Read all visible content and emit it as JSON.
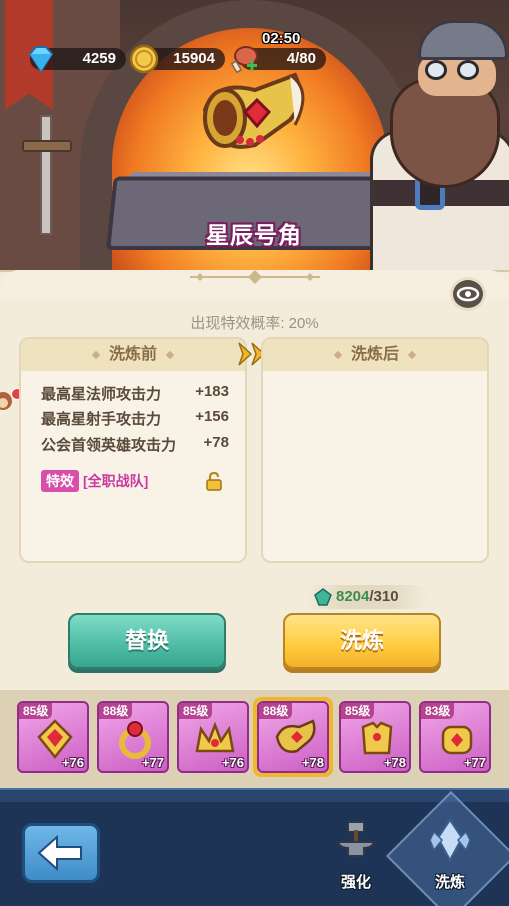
{
  "resources": {
    "gems": "4259",
    "coins": "15904",
    "stamina": "4/80",
    "timer": "02:50"
  },
  "item": {
    "name": "星辰号角"
  },
  "panel": {
    "chance_text": "出现特效概率: 20%",
    "before_header": "洗炼前",
    "after_header": "洗炼后",
    "stats": [
      {
        "name": "最高星法师攻击力",
        "value": "+183"
      },
      {
        "name": "最高星射手攻击力",
        "value": "+156"
      },
      {
        "name": "公会首领英雄攻击力",
        "value": "+78"
      }
    ],
    "special_tag": "特效",
    "special_value": "[全职战队]"
  },
  "cost": {
    "have": "8204",
    "need": "/310"
  },
  "buttons": {
    "replace": "替换",
    "refine": "洗炼"
  },
  "equipment": [
    {
      "level": "85级",
      "bonus": "+76"
    },
    {
      "level": "88级",
      "bonus": "+77"
    },
    {
      "level": "85级",
      "bonus": "+76"
    },
    {
      "level": "88级",
      "bonus": "+78"
    },
    {
      "level": "85级",
      "bonus": "+78"
    },
    {
      "level": "83级",
      "bonus": "+77"
    }
  ],
  "nav": {
    "forge_label": "强化",
    "refine_label": "洗炼"
  },
  "icons": {
    "gem": "diamond-icon",
    "coin": "coin-icon",
    "stamina": "meat-icon",
    "eye": "eye-icon",
    "lock": "lock-icon",
    "back": "back-arrow-icon",
    "forge": "anvil-icon",
    "refine": "crystal-icon"
  },
  "colors": {
    "special_pink": "#d84fa9",
    "replace_green": "#4dbba4",
    "refine_gold": "#ffcb3d",
    "nav_blue": "#1e3457"
  }
}
